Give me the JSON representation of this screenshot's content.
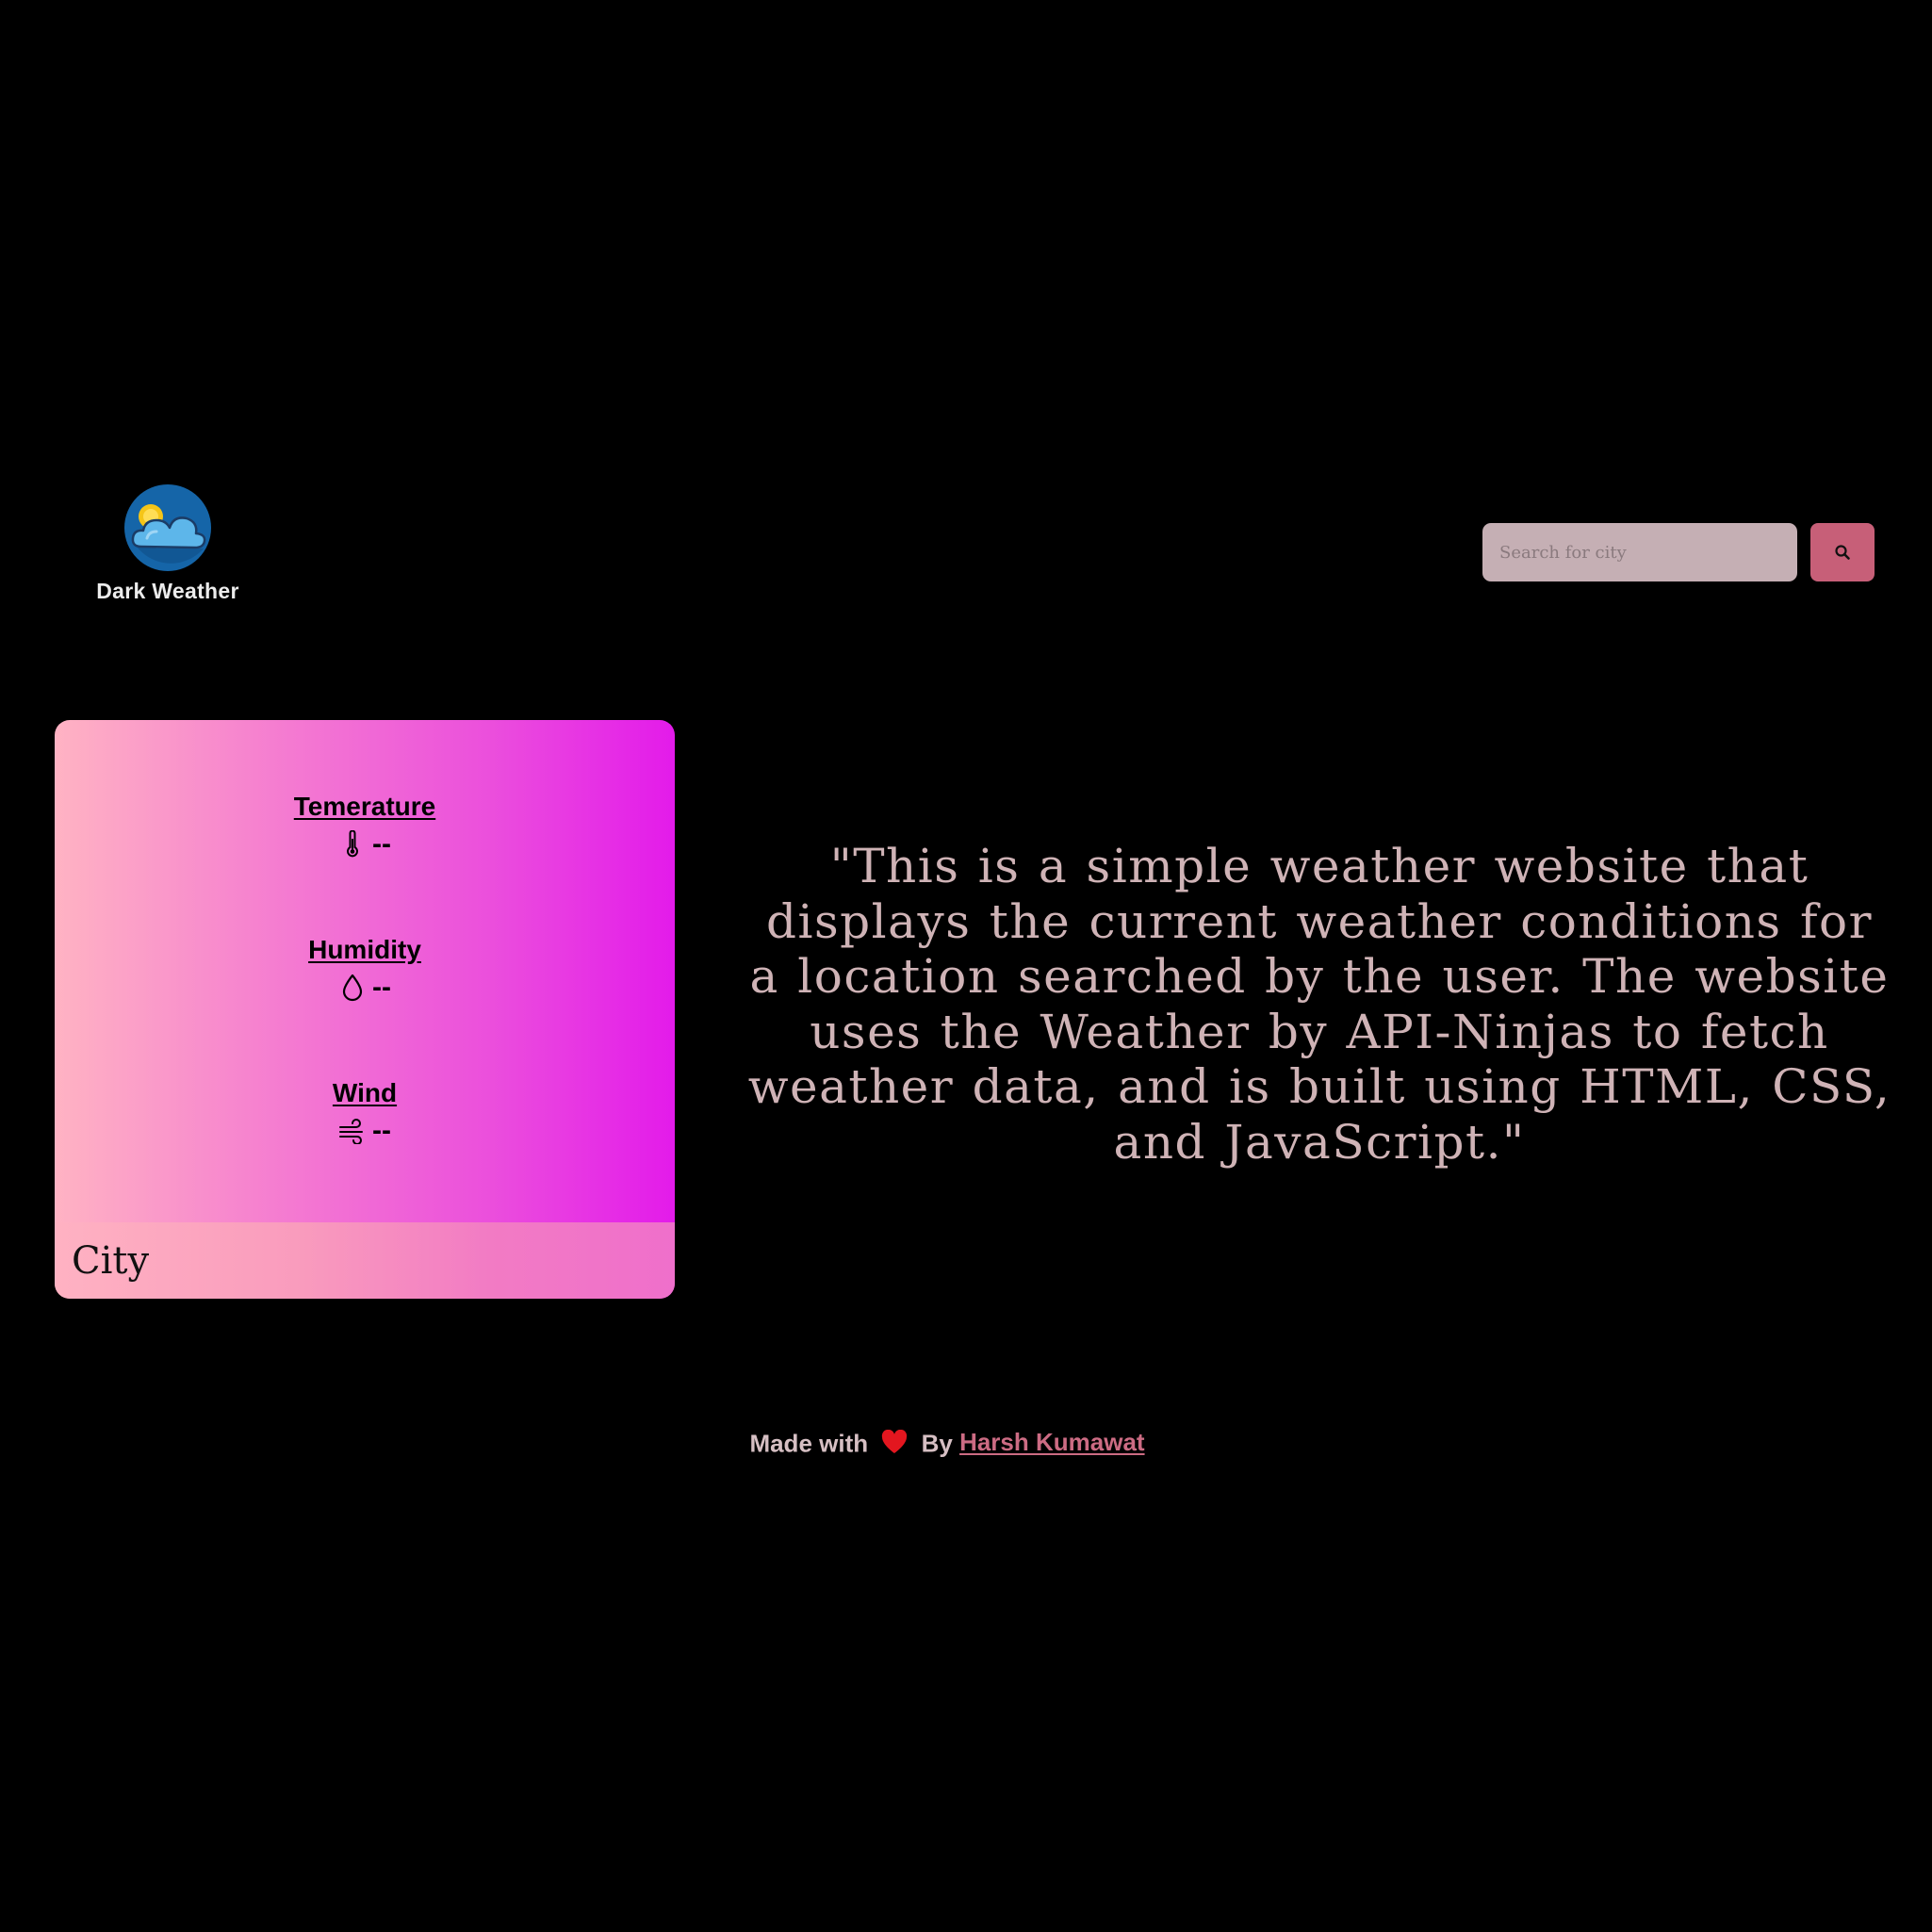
{
  "header": {
    "brand_name": "Dark Weather",
    "logo_icon": "sun-behind-cloud-icon"
  },
  "search": {
    "placeholder": "Search for city",
    "value": "",
    "button_icon": "search-icon"
  },
  "card": {
    "metrics": [
      {
        "title": "Temerature",
        "icon": "thermometer-icon",
        "value": "--"
      },
      {
        "title": "Humidity",
        "icon": "droplet-icon",
        "value": "--"
      },
      {
        "title": "Wind",
        "icon": "wind-icon",
        "value": "--"
      }
    ],
    "city": "City"
  },
  "description": "\"This is a simple weather website that displays the current weather conditions for a location searched by the user. The website uses the Weather by API-Ninjas to fetch weather data, and is built using HTML, CSS, and JavaScript.\"",
  "footer": {
    "made_with": "Made with",
    "by": "By",
    "author": "Harsh Kumawat",
    "heart_icon": "heart-icon"
  },
  "colors": {
    "background": "#000000",
    "accent": "#c75f78",
    "search_field": "#c5afb4",
    "text_muted": "#cfb3b6",
    "card_gradient_start": "#ffb3c3",
    "card_gradient_end": "#e31bea"
  }
}
